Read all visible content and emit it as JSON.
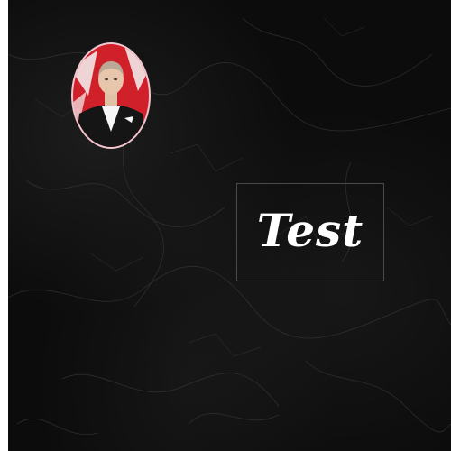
{
  "title": {
    "text": "Test"
  },
  "portrait": {
    "icon": "portrait-medallion-icon",
    "frame_color": "#f2c6cf",
    "flag_color": "#d0202a"
  },
  "colors": {
    "background": "#0c0c0c",
    "title_text": "#ffffff",
    "box_border": "#4a4a4a"
  }
}
